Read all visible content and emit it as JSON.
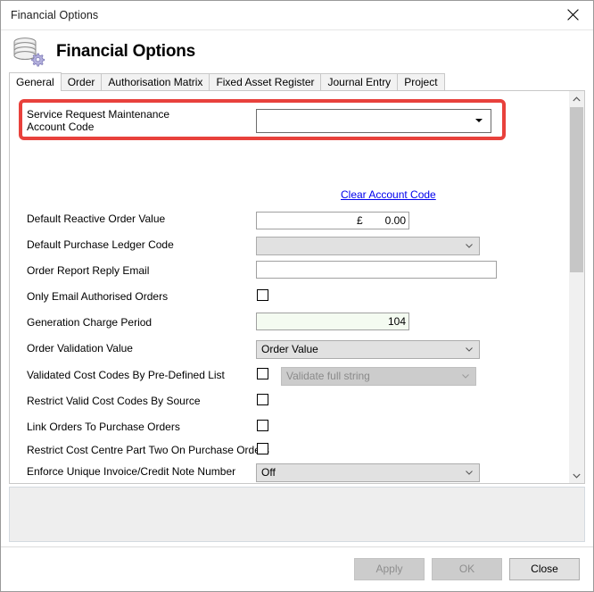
{
  "window": {
    "title": "Financial Options",
    "close_icon": "close-icon"
  },
  "header": {
    "title": "Financial Options",
    "icon": "coins-gear-icon"
  },
  "tabs": [
    {
      "label": "General",
      "active": true
    },
    {
      "label": "Order",
      "active": false
    },
    {
      "label": "Authorisation Matrix",
      "active": false
    },
    {
      "label": "Fixed Asset Register",
      "active": false
    },
    {
      "label": "Journal Entry",
      "active": false
    },
    {
      "label": "Project",
      "active": false
    }
  ],
  "form": {
    "service_request_account_code": {
      "label": "Service Request Maintenance\nAccount Code",
      "value": "",
      "highlighted": true
    },
    "clear_account_code_link": "Clear Account Code",
    "default_reactive_order_value": {
      "label": "Default Reactive Order Value",
      "currency_symbol": "£",
      "value": "0.00"
    },
    "default_purchase_ledger_code": {
      "label": "Default Purchase Ledger Code",
      "value": ""
    },
    "order_report_reply_email": {
      "label": "Order Report Reply Email",
      "value": ""
    },
    "only_email_authorised_orders": {
      "label": "Only Email Authorised Orders",
      "checked": false
    },
    "generation_charge_period": {
      "label": "Generation Charge Period",
      "value": "104"
    },
    "order_validation_value": {
      "label": "Order Validation Value",
      "value": "Order Value"
    },
    "validated_cost_codes": {
      "label": "Validated Cost Codes By Pre-Defined List",
      "checked": false,
      "dropdown_value": "Validate full string",
      "dropdown_disabled": true
    },
    "restrict_valid_cost_codes_by_source": {
      "label": "Restrict Valid Cost Codes By Source",
      "checked": false
    },
    "link_orders_to_purchase_orders": {
      "label": "Link Orders To Purchase Orders",
      "checked": false
    },
    "restrict_cost_centre_part_two": {
      "label": "Restrict Cost Centre Part Two On Purchase Orders",
      "checked": false
    },
    "enforce_unique_invoice": {
      "label": "Enforce Unique Invoice/Credit Note Number",
      "value": "Off"
    }
  },
  "buttons": {
    "apply": "Apply",
    "ok": "OK",
    "close": "Close"
  },
  "colors": {
    "highlight": "#e8413c",
    "link": "#0000ee",
    "green_field": "#f4fbf1"
  }
}
